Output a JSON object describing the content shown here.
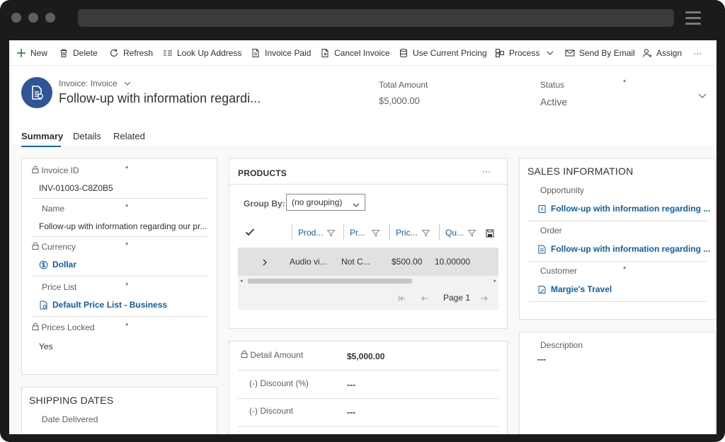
{
  "commands": [
    {
      "label": "New",
      "icon": "plus-icon"
    },
    {
      "label": "Delete",
      "icon": "trash-icon"
    },
    {
      "label": "Refresh",
      "icon": "refresh-icon"
    },
    {
      "label": "Look Up Address",
      "icon": "address-icon"
    },
    {
      "label": "Invoice Paid",
      "icon": "document-icon"
    },
    {
      "label": "Cancel Invoice",
      "icon": "document-cancel-icon"
    },
    {
      "label": "Use Current Pricing",
      "icon": "database-icon"
    },
    {
      "label": "Process",
      "icon": "process-icon"
    },
    {
      "label": "Send By Email",
      "icon": "email-icon"
    },
    {
      "label": "Assign",
      "icon": "person-icon"
    },
    {
      "label": "···",
      "icon": "more-icon"
    }
  ],
  "header": {
    "entity_type": "Invoice: Invoice",
    "title": "Follow-up with information regardi...",
    "total_amount_label": "Total Amount",
    "total_amount_value": "$5,000.00",
    "status_label": "Status",
    "status_value": "Active",
    "required_marker": "*"
  },
  "tabs": [
    "Summary",
    "Details",
    "Related"
  ],
  "summary": {
    "invoice_id_label": "Invoice ID",
    "invoice_id_value": "INV-01003-C8Z0B5",
    "name_label": "Name",
    "name_value": "Follow-up with information regarding our pr...",
    "currency_label": "Currency",
    "currency_value": "Dollar",
    "price_list_label": "Price List",
    "price_list_value": "Default Price List - Business",
    "prices_locked_label": "Prices Locked",
    "prices_locked_value": "Yes"
  },
  "shipping": {
    "title": "SHIPPING DATES",
    "date_delivered_label": "Date Delivered"
  },
  "products": {
    "title": "PRODUCTS",
    "more": "···",
    "group_by_label": "Group By:",
    "group_by_value": "(no grouping)",
    "columns": [
      "Prod...",
      "Pr...",
      "Pric...",
      "Qu..."
    ],
    "rows": [
      {
        "product": "Audio vi...",
        "pr": "Not C...",
        "price": "$500.00",
        "qty": "10.00000"
      }
    ],
    "page_label": "Page 1"
  },
  "amounts": {
    "detail_amount_label": "Detail Amount",
    "detail_amount_value": "$5,000.00",
    "discount_pct_label": "(-) Discount (%)",
    "discount_pct_value": "---",
    "discount_label": "(-) Discount",
    "discount_value": "---"
  },
  "sales": {
    "title": "SALES INFORMATION",
    "opportunity_label": "Opportunity",
    "opportunity_value": "Follow-up with information regarding ...",
    "order_label": "Order",
    "order_value": "Follow-up with information regarding ...",
    "customer_label": "Customer",
    "customer_value": "Margie's Travel"
  },
  "description": {
    "label": "Description",
    "value": "---"
  },
  "colors": {
    "accent": "#2f5597",
    "link": "#115ea3",
    "required": "#a4262c"
  }
}
